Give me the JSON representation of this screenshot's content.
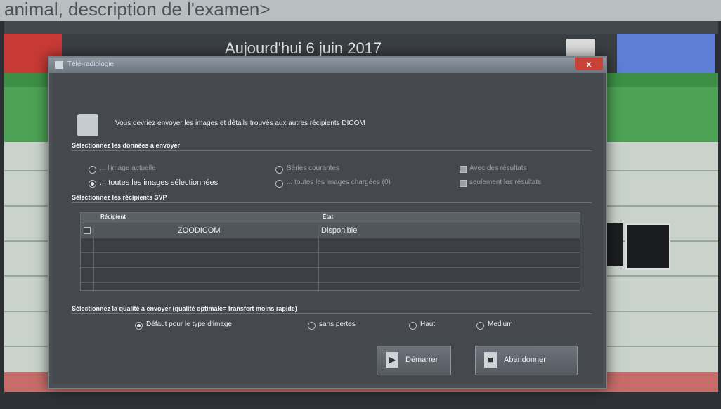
{
  "background": {
    "title": "animal, description de l'examen>",
    "date": "Aujourd'hui 6 juin 2017"
  },
  "dialog": {
    "title": "Télé-radiologie",
    "close_label": "x",
    "intro": "Vous devriez envoyer les images et détails trouvés aux autres récipients DICOM",
    "section_data": "Sélectionnez les données à envoyer",
    "options": {
      "image_actuelle": "... l'image actuelle",
      "toutes_selectionnees": "... toutes les images sélectionnées",
      "series_courantes": "Séries courantes",
      "toutes_chargees": "... toutes les images chargées (0)",
      "avec_resultats": "Avec des résultats",
      "seulement_resultats": "seulement les résultats"
    },
    "section_recipients": "Sélectionnez les récipients SVP",
    "table": {
      "columns": [
        "Récipient",
        "État"
      ],
      "rows": [
        {
          "recipient": "ZOODICOM",
          "state": "Disponible"
        }
      ]
    },
    "section_quality": "Sélectionnez la qualité à envoyer (qualité optimale= transfert moins rapide)",
    "quality": {
      "default": "Défaut pour le type d'image",
      "lossless": "sans pertes",
      "high": "Haut",
      "medium": "Medium"
    },
    "buttons": {
      "start": "Démarrer",
      "abort": "Abandonner"
    }
  }
}
